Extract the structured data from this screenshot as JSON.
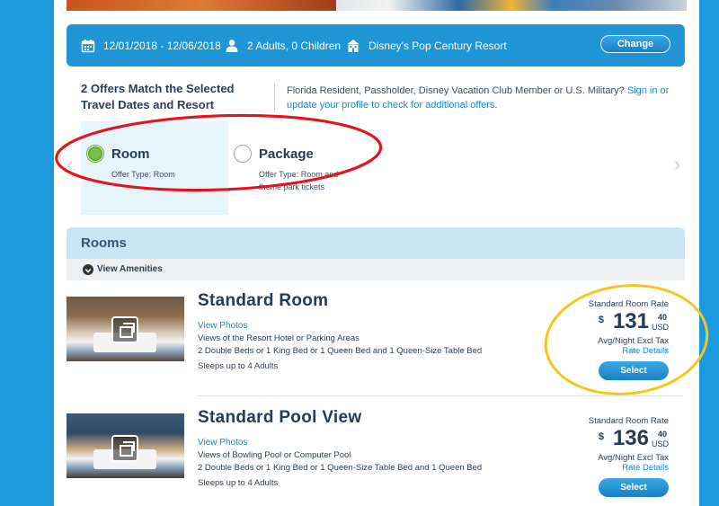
{
  "summary": {
    "dates": "12/01/2018 - 12/06/2018",
    "guests": "2 Adults, 0 Children",
    "resort": "Disney's Pop Century Resort",
    "change_label": "Change"
  },
  "offers": {
    "title": "2 Offers Match the Selected Travel Dates and Resort",
    "resident_text": "Florida Resident, Passholder, Disney Vacation Club Member or U.S. Military?",
    "signin_text": "Sign in or update your profile to check for additional offers.",
    "items": [
      {
        "name": "Room",
        "type": "Offer Type: Room",
        "selected": true
      },
      {
        "name": "Package",
        "type": "Offer Type: Room and theme park tickets",
        "selected": false
      }
    ]
  },
  "rooms_section": {
    "title": "Rooms",
    "amenities_label": "View Amenities"
  },
  "rooms": [
    {
      "name": "Standard Room",
      "view_photos": "View Photos",
      "views": "Views of the Resort Hotel or Parking Areas",
      "beds": "2 Double Beds or 1 King Bed or 1 Queen Bed and 1 Queen-Size Table Bed",
      "sleeps": "Sleeps up to 4 Adults",
      "rate_label": "Standard Room Rate",
      "currency_symbol": "$",
      "price_int": "131",
      "price_cents": "40",
      "currency": "USD",
      "avg_label": "Avg/Night Excl Tax",
      "rate_details": "Rate Details",
      "select_label": "Select"
    },
    {
      "name": "Standard Pool View",
      "view_photos": "View Photos",
      "views": "Views of Bowling Pool or Computer Pool",
      "beds": "2 Double Beds or 1 King Bed or 1 Queen-Size Table Bed and 1 Queen Bed",
      "sleeps": "Sleeps up to 4 Adults",
      "rate_label": "Standard Room Rate",
      "currency_symbol": "$",
      "price_int": "136",
      "price_cents": "40",
      "currency": "USD",
      "avg_label": "Avg/Night Excl Tax",
      "rate_details": "Rate Details",
      "select_label": "Select"
    }
  ],
  "colors": {
    "background": "#1b9ae0",
    "summary_bar": "#1f95d6",
    "link": "#1e89c8",
    "selected_radio": "#7ac142",
    "annotation_red": "#e3141b",
    "annotation_yellow": "#f2c81e"
  },
  "icons": {
    "calendar": "calendar-icon",
    "guests": "person-icon",
    "resort": "building-icon",
    "photos": "photo-gallery-icon",
    "amenities": "chevron-down-icon"
  }
}
